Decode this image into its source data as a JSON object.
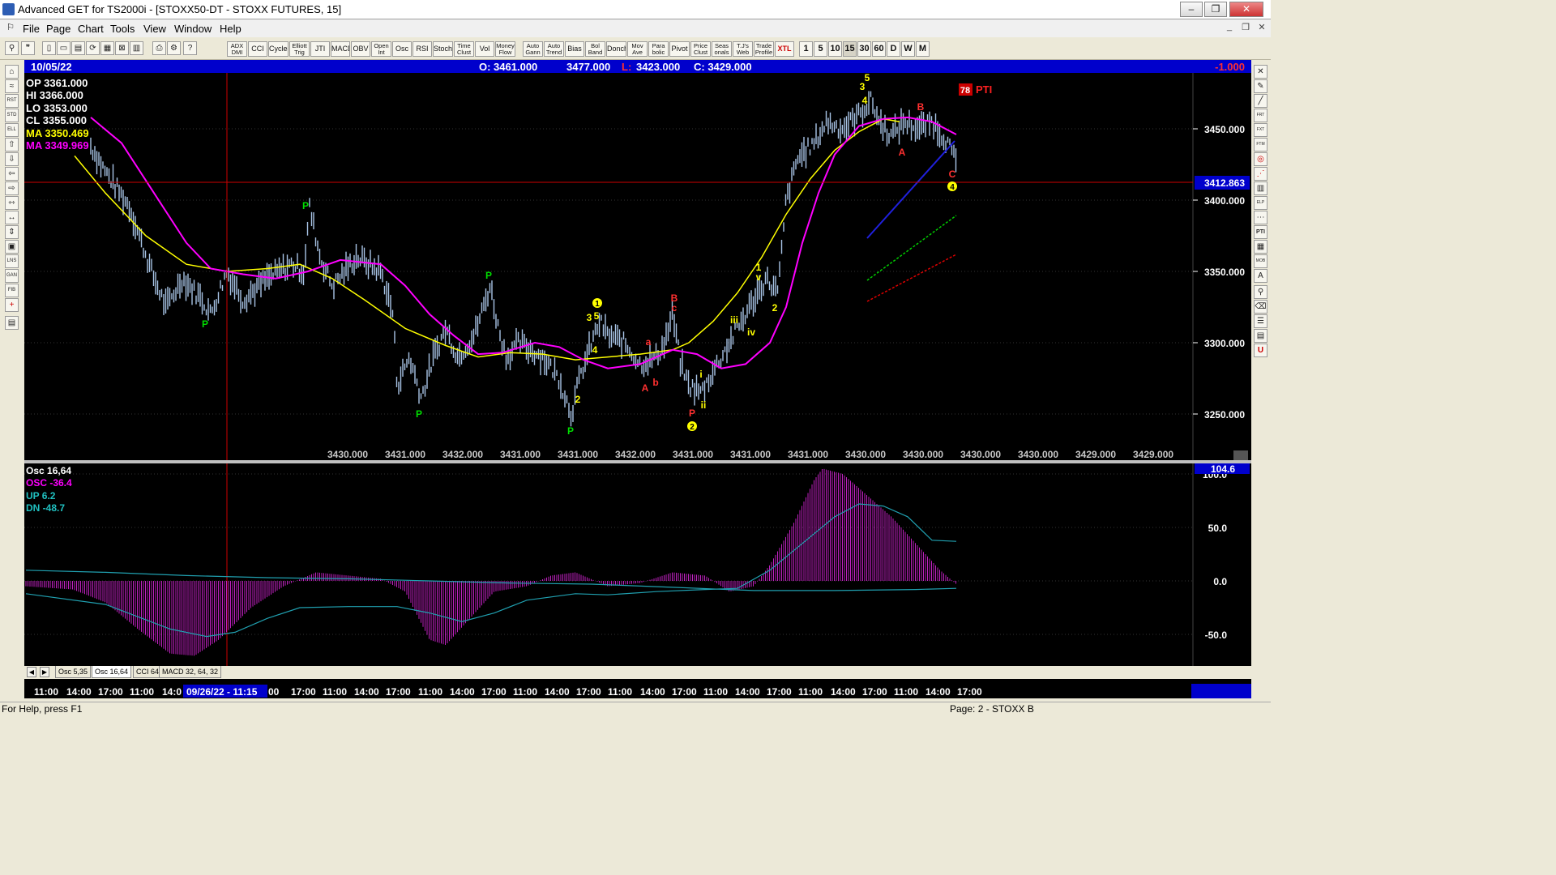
{
  "window": {
    "title": "Advanced GET for TS2000i - [STOXX50-DT - STOXX FUTURES, 15]",
    "btn_min": "‒",
    "btn_max": "❐",
    "btn_close": "✕"
  },
  "menu": {
    "items": [
      "File",
      "Page",
      "Chart",
      "Tools",
      "View",
      "Window",
      "Help"
    ],
    "mdi_min": "_",
    "mdi_restore": "❐",
    "mdi_close": "✕"
  },
  "toolbar": {
    "studies": [
      "ADX DMI",
      "CCI",
      "Cycles",
      "Elliott Trig",
      "JTI",
      "MACD",
      "OBV",
      "Open Int",
      "Osc",
      "RSI",
      "Stoch",
      "Time Clust",
      "Vol",
      "Money Flow",
      "Auto Gann",
      "Auto Trend",
      "Bias",
      "Bol Band",
      "Donch",
      "Mov Ave",
      "Para bolic",
      "Pivot",
      "Price Clust",
      "Seas onals",
      "T.J's Web",
      "Trade Profile",
      "XTL"
    ],
    "timeframes": [
      "1",
      "5",
      "10",
      "15",
      "30",
      "60",
      "D",
      "W",
      "M"
    ],
    "selected_timeframe": "15"
  },
  "chart_header": {
    "date": "10/05/22",
    "open": "O: 3461.000",
    "high": "3477.000",
    "low_label": "L:",
    "low": "3423.000",
    "close": "C: 3429.000",
    "change": "-1.000"
  },
  "price_panel": {
    "op": "OP  3361.000",
    "hi": "HI   3366.000",
    "lo": "LO  3353.000",
    "cl": "CL  3355.000",
    "ma1": "MA  3350.469",
    "ma2": "MA  3349.969",
    "pti_value": "78",
    "pti_label": "PTI",
    "current_price": "3412.863",
    "y_ticks": [
      "3450.000",
      "3400.000",
      "3350.000",
      "3300.000",
      "3250.000"
    ],
    "bottom_values": [
      "3430.000",
      "3431.000",
      "3432.000",
      "3431.000",
      "3431.000",
      "3432.000",
      "3431.000",
      "3431.000",
      "3431.000",
      "3430.000",
      "3430.000",
      "3430.000",
      "3430.000",
      "3429.000",
      "3429.000"
    ],
    "colors": {
      "ma_yellow": "#ffff00",
      "ma_magenta": "#ff00ff",
      "bars": "#a8c4e6",
      "pivot": "#00dd00",
      "wave": "#ffff00",
      "abc": "#ff2020"
    }
  },
  "osc_panel": {
    "title": "Osc 16,64",
    "osc": "OSC -36.4",
    "up": "UP   6.2",
    "dn": "DN   -48.7",
    "current": "104.6",
    "y_ticks": [
      "100.0",
      "50.0",
      "0.0",
      "-50.0"
    ]
  },
  "tabs": [
    "Osc 5,35",
    "Osc 16,64",
    "CCI 64",
    "MACD 32, 64, 32"
  ],
  "active_tab": "Osc 16,64",
  "tab_nav_prev": "◀",
  "tab_nav_next": "▶",
  "time_axis": {
    "labels": [
      "11:00",
      "14:00",
      "17:00",
      "11:00",
      "14:0",
      "00",
      "17:00",
      "11:00",
      "14:00",
      "17:00",
      "11:00",
      "14:00",
      "17:00",
      "11:00",
      "14:00",
      "17:00",
      "11:00",
      "14:00",
      "17:00",
      "11:00",
      "14:00",
      "17:00",
      "11:00",
      "14:00",
      "17:00",
      "11:00",
      "14:00",
      "17:00"
    ],
    "cursor": "09/26/22 - 11:15"
  },
  "status": {
    "help": "For Help, press F1",
    "page": "Page: 2 - STOXX B"
  },
  "annotations": {
    "pivots": [
      "P",
      "P",
      "P",
      "P",
      "P",
      "P"
    ],
    "waves": [
      "1",
      "2",
      "3",
      "4",
      "5",
      "3",
      "4",
      "5",
      "2",
      "i",
      "ii",
      "iii",
      "iv",
      "v",
      "2"
    ],
    "circled": [
      "1",
      "2",
      "4"
    ],
    "abc": [
      "A",
      "a",
      "b",
      "B",
      "c",
      "A",
      "B",
      "C",
      "P"
    ]
  }
}
